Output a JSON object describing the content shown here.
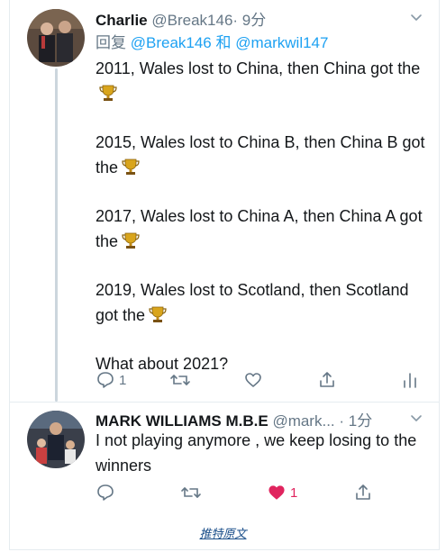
{
  "tweets": [
    {
      "name": "Charlie",
      "handle": "@Break146",
      "time": "· 9分",
      "reply_prefix": "回复",
      "reply_handle_1": "@Break146",
      "reply_joiner": "和",
      "reply_handle_2": "@markwil147",
      "paragraphs": [
        {
          "text": "2011, Wales lost to China, then China got the",
          "emoji": "trophy-icon"
        },
        {
          "text": "2015, Wales lost to China B, then China B got the",
          "emoji": "trophy-icon"
        },
        {
          "text": "2017, Wales lost to China A, then China A got the",
          "emoji": "trophy-icon"
        },
        {
          "text": "2019, Wales lost to Scotland, then Scotland got the",
          "emoji": "trophy-icon"
        },
        {
          "text": "What about 2021?",
          "emoji": ""
        }
      ],
      "reply_count": "1",
      "retweet_count": "",
      "like_count": ""
    },
    {
      "name": "MARK WILLIAMS M.B.E",
      "handle": "@mark...",
      "time": "· 1分",
      "text": "I not playing anymore , we keep losing to the winners",
      "reply_count": "",
      "retweet_count": "",
      "like_count": "1",
      "liked": true
    }
  ],
  "footer": {
    "link_text": "推特原文"
  },
  "colors": {
    "accent": "#1da1f2",
    "like": "#e0245e",
    "muted": "#657786"
  }
}
